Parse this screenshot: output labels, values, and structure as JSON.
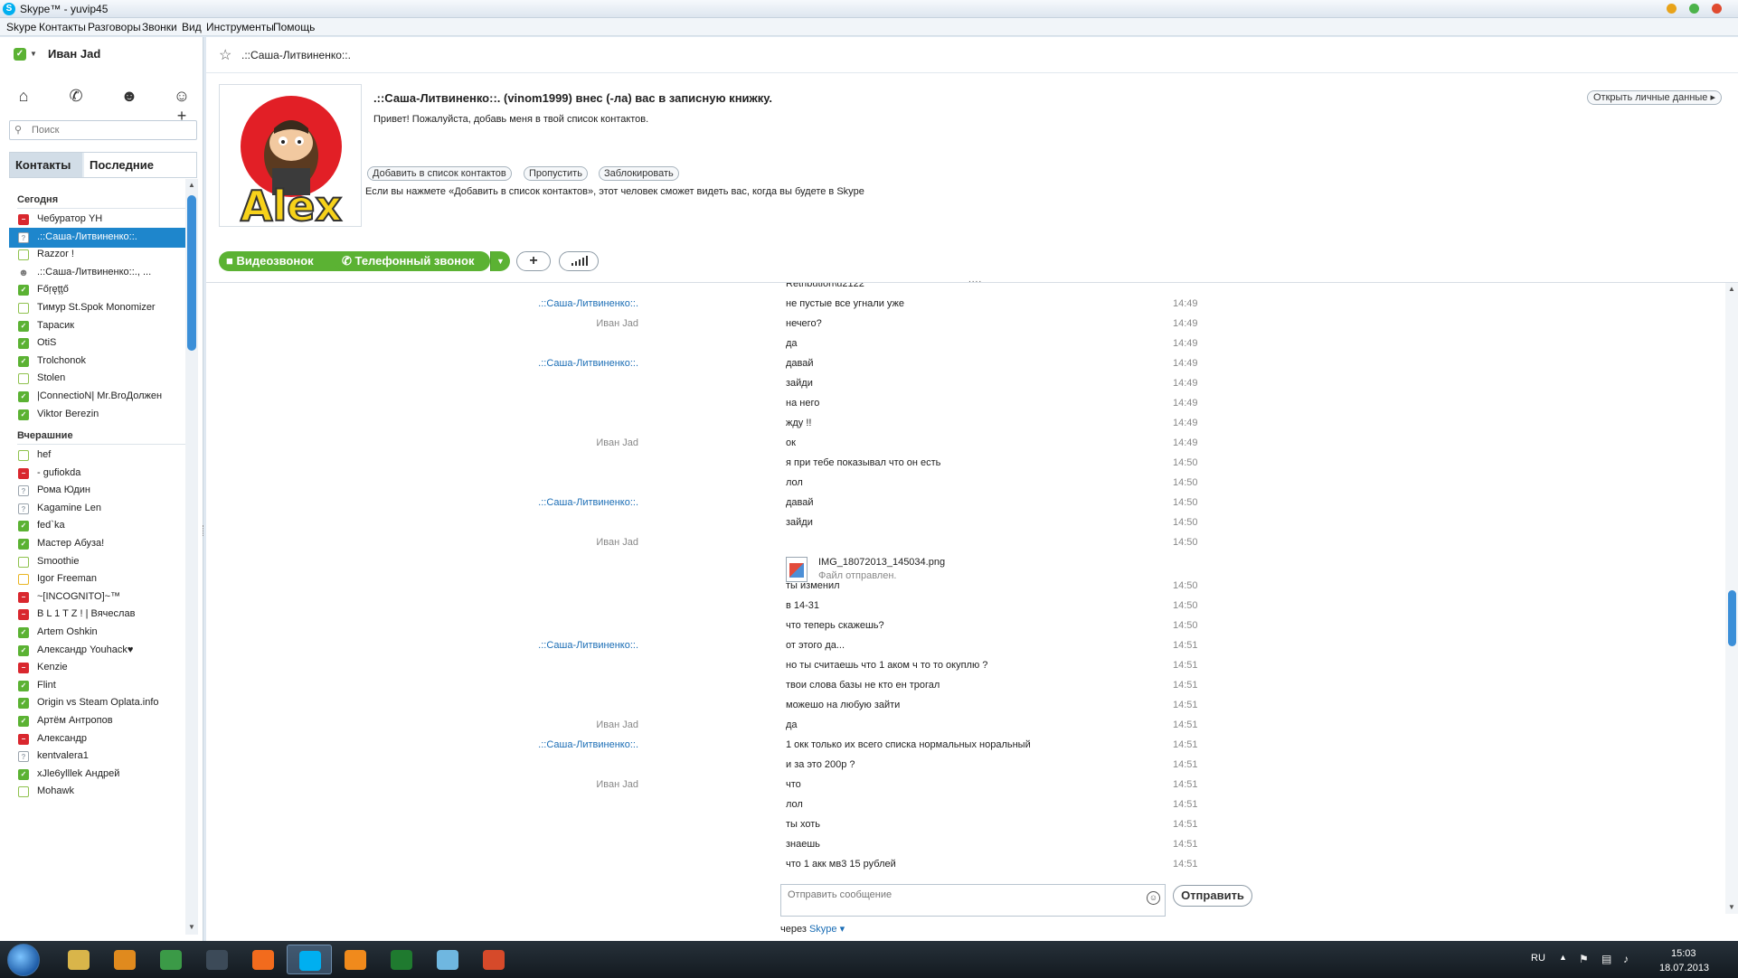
{
  "window": {
    "title": "Skype™ - yuvip45",
    "logo": "S"
  },
  "menu": [
    "Skype",
    "Контакты",
    "Разговоры",
    "Звонки",
    "Вид",
    "Инструменты",
    "Помощь"
  ],
  "profile": {
    "name": "Иван Jad",
    "status": "online"
  },
  "toolbar_icons": [
    "home-icon",
    "phone-icon",
    "group-icon",
    "add-contact-icon"
  ],
  "search": {
    "placeholder": "Поиск"
  },
  "tabs": {
    "contacts": "Контакты",
    "recent": "Последние"
  },
  "groups": {
    "today": "Сегодня",
    "yesterday": "Вчерашние"
  },
  "contacts_today": [
    {
      "name": "Чебуратор YH",
      "status": "busy"
    },
    {
      "name": ".::Саша-Литвиненко::.",
      "status": "unknown",
      "selected": true
    },
    {
      "name": "Razzor !",
      "status": "offline"
    },
    {
      "name": ".::Саша-Литвиненко::., ...",
      "status": "group"
    },
    {
      "name": "Főŗęţţő",
      "status": "online"
    },
    {
      "name": "Тимур St.Spok Monomizer",
      "status": "offline"
    },
    {
      "name": "Тарасик",
      "status": "online"
    },
    {
      "name": "OtiS",
      "status": "online"
    },
    {
      "name": "Trolchonok",
      "status": "online"
    },
    {
      "name": "Stolen",
      "status": "offline"
    },
    {
      "name": "|ConnectioN| Mr.BroДолжен",
      "status": "online"
    },
    {
      "name": "Viktor Berezin",
      "status": "online"
    }
  ],
  "contacts_yesterday": [
    {
      "name": "hef",
      "status": "offline"
    },
    {
      "name": "- gufiokda",
      "status": "busy"
    },
    {
      "name": "Рома Юдин",
      "status": "unknown"
    },
    {
      "name": "Kagamine Len",
      "status": "unknown"
    },
    {
      "name": "fed`ka",
      "status": "online"
    },
    {
      "name": "Мастер Абуза!",
      "status": "online"
    },
    {
      "name": "Smoothie",
      "status": "offline"
    },
    {
      "name": "Igor Freeman",
      "status": "away"
    },
    {
      "name": "~[INCOGNITO]~™",
      "status": "busy"
    },
    {
      "name": "B L 1 T Z ! | Вячеслав",
      "status": "busy"
    },
    {
      "name": "Artem Oshkin",
      "status": "online"
    },
    {
      "name": "Александр Youhack♥",
      "status": "online"
    },
    {
      "name": "Kenzie",
      "status": "busy"
    },
    {
      "name": "Flint",
      "status": "online"
    },
    {
      "name": "Origin vs  Steam   Oplata.info",
      "status": "online"
    },
    {
      "name": "Артём Антропов",
      "status": "online"
    },
    {
      "name": "Александр",
      "status": "busy"
    },
    {
      "name": "kentvalera1",
      "status": "unknown"
    },
    {
      "name": "xJle6ylllek Андрей",
      "status": "online"
    },
    {
      "name": "Mohawk",
      "status": "offline"
    }
  ],
  "chat": {
    "title": ".::Саша-Литвиненко::.",
    "auth_title": ".::Саша-Литвиненко::. (vinom1999) внес (-ла) вас в записную книжку.",
    "auth_message": "Привет! Пожалуйста, добавь меня в твой список контактов.",
    "btn_add": "Добавить в список контактов",
    "btn_skip": "Пропустить",
    "btn_block": "Заблокировать",
    "auth_note": "Если вы нажмете «Добавить в список контактов», этот человек сможет видеть вас, когда вы будете в Skype",
    "open_profile": "Открыть личные данные ▸",
    "video_call": "Видеозвонок",
    "phone_call": "Телефонный звонок",
    "avatar_text": "Alex",
    "input_placeholder": "Отправить сообщение",
    "send": "Отправить",
    "via_prefix": "через",
    "via_link": "Skype ▾"
  },
  "messages": [
    {
      "sender": "",
      "who": "",
      "text": "Retribution\\u2122",
      "time": ""
    },
    {
      "sender": ".::Саша-Литвиненко::.",
      "who": "them",
      "text": "не пустые все угнали уже",
      "time": "14:49"
    },
    {
      "sender": "Иван Jad",
      "who": "me",
      "text": "нечего?",
      "time": "14:49"
    },
    {
      "sender": "",
      "who": "",
      "text": "да",
      "time": "14:49"
    },
    {
      "sender": ".::Саша-Литвиненко::.",
      "who": "them",
      "text": "давай",
      "time": "14:49"
    },
    {
      "sender": "",
      "who": "",
      "text": "зайди",
      "time": "14:49"
    },
    {
      "sender": "",
      "who": "",
      "text": "на него",
      "time": "14:49"
    },
    {
      "sender": "",
      "who": "",
      "text": "жду !!",
      "time": "14:49"
    },
    {
      "sender": "Иван Jad",
      "who": "me",
      "text": "ок",
      "time": "14:49"
    },
    {
      "sender": "",
      "who": "",
      "text": "я при тебе показывал что он есть",
      "time": "14:50"
    },
    {
      "sender": "",
      "who": "",
      "text": "лол",
      "time": "14:50"
    },
    {
      "sender": ".::Саша-Литвиненко::.",
      "who": "them",
      "text": "давай",
      "time": "14:50"
    },
    {
      "sender": "",
      "who": "",
      "text": "зайди",
      "time": "14:50"
    },
    {
      "sender": "Иван Jad",
      "who": "me",
      "text": "",
      "time": "14:50",
      "file": true
    },
    {
      "sender": "",
      "who": "",
      "text": "ты изменил",
      "time": "14:50"
    },
    {
      "sender": "",
      "who": "",
      "text": "в 14-31",
      "time": "14:50"
    },
    {
      "sender": "",
      "who": "",
      "text": "что теперь скажешь?",
      "time": "14:50"
    },
    {
      "sender": ".::Саша-Литвиненко::.",
      "who": "them",
      "text": "от этого да...",
      "time": "14:51"
    },
    {
      "sender": "",
      "who": "",
      "text": "но ты считаешь что 1 аком ч то то окуплю ?",
      "time": "14:51"
    },
    {
      "sender": "",
      "who": "",
      "text": "твои слова базы не кто ен трогал",
      "time": "14:51"
    },
    {
      "sender": "",
      "who": "",
      "text": "можешо на любую зайти",
      "time": "14:51"
    },
    {
      "sender": "Иван Jad",
      "who": "me",
      "text": "да",
      "time": "14:51"
    },
    {
      "sender": ".::Саша-Литвиненко::.",
      "who": "them",
      "text": "1 окк только их всего списка нормальных норальный",
      "time": "14:51"
    },
    {
      "sender": "",
      "who": "",
      "text": "и за это 200р ?",
      "time": "14:51"
    },
    {
      "sender": "Иван Jad",
      "who": "me",
      "text": "что",
      "time": "14:51"
    },
    {
      "sender": "",
      "who": "",
      "text": "лол",
      "time": "14:51"
    },
    {
      "sender": "",
      "who": "",
      "text": "ты хоть",
      "time": "14:51"
    },
    {
      "sender": "",
      "who": "",
      "text": "знаешь",
      "time": "14:51"
    },
    {
      "sender": "",
      "who": "",
      "text": "что 1 акк мв3 15 рублей",
      "time": "14:51"
    }
  ],
  "file": {
    "name": "IMG_18072013_145034.png",
    "status": "Файл отправлен."
  },
  "taskbar": {
    "apps": [
      "file-explorer-icon",
      "media-player-icon",
      "chrome-icon",
      "steam-icon",
      "origin-icon",
      "skype-icon",
      "aimp-icon",
      "ea-icon",
      "notepad-icon",
      "office-icon"
    ],
    "lang": "RU",
    "time": "15:03",
    "date": "18.07.2013"
  },
  "colors": {
    "accent": "#1e86cc",
    "online": "#5bb233",
    "busy": "#d9272e",
    "away": "#e9b523"
  }
}
